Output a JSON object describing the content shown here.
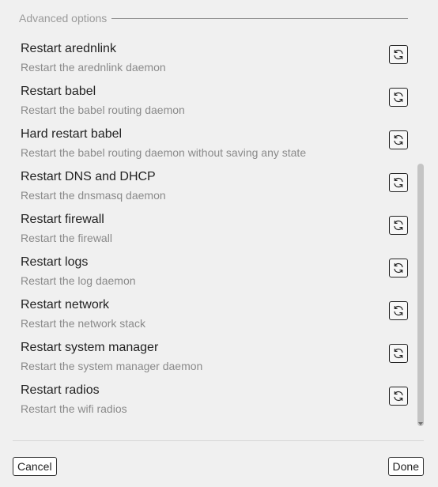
{
  "section": {
    "title": "Advanced options"
  },
  "options": [
    {
      "title": "Restart arednlink",
      "description": "Restart the arednlink daemon",
      "button_icon": "refresh-icon"
    },
    {
      "title": "Restart babel",
      "description": "Restart the babel routing daemon",
      "button_icon": "refresh-icon"
    },
    {
      "title": "Hard restart babel",
      "description": "Restart the babel routing daemon without saving any state",
      "button_icon": "refresh-icon"
    },
    {
      "title": "Restart DNS and DHCP",
      "description": "Restart the dnsmasq daemon",
      "button_icon": "refresh-icon"
    },
    {
      "title": "Restart firewall",
      "description": "Restart the firewall",
      "button_icon": "refresh-icon"
    },
    {
      "title": "Restart logs",
      "description": "Restart the log daemon",
      "button_icon": "refresh-icon"
    },
    {
      "title": "Restart network",
      "description": "Restart the network stack",
      "button_icon": "refresh-icon"
    },
    {
      "title": "Restart system manager",
      "description": "Restart the system manager daemon",
      "button_icon": "refresh-icon"
    },
    {
      "title": "Restart radios",
      "description": "Restart the wifi radios",
      "button_icon": "refresh-icon"
    }
  ],
  "scroll": {
    "position_fraction": 0.38,
    "visible_fraction": 0.61
  },
  "footer": {
    "cancel_label": "Cancel",
    "done_label": "Done"
  },
  "colors": {
    "background": "#f0f0f0",
    "text": "#222222",
    "muted_text": "#8a8a8a"
  }
}
